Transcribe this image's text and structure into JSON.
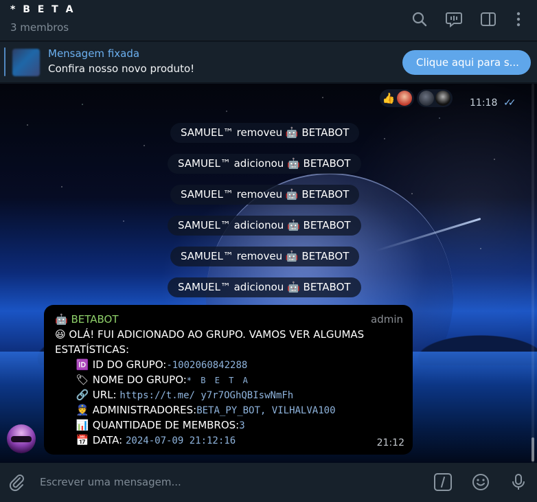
{
  "header": {
    "title": "* B E T A",
    "subtitle": "3 membros"
  },
  "pinned": {
    "title": "Mensagem fixada",
    "text": "Confira nosso novo produto!",
    "button_label": "Clique aqui para s..."
  },
  "top_message": {
    "time": "11:18",
    "ticks": "✓✓"
  },
  "service_messages": [
    {
      "actor": "SAMUEL™",
      "action": "removeu",
      "emoji": "🤖",
      "target": "BETABOT"
    },
    {
      "actor": "SAMUEL™",
      "action": "adicionou",
      "emoji": "🤖",
      "target": "BETABOT"
    },
    {
      "actor": "SAMUEL™",
      "action": "removeu",
      "emoji": "🤖",
      "target": "BETABOT"
    },
    {
      "actor": "SAMUEL™",
      "action": "adicionou",
      "emoji": "🤖",
      "target": "BETABOT"
    },
    {
      "actor": "SAMUEL™",
      "action": "removeu",
      "emoji": "🤖",
      "target": "BETABOT"
    },
    {
      "actor": "SAMUEL™",
      "action": "adicionou",
      "emoji": "🤖",
      "target": "BETABOT"
    }
  ],
  "bot_message": {
    "sender_emoji": "🤖",
    "sender": "BETABOT",
    "role": "admin",
    "greeting_emoji": "😃",
    "greeting_line1": "OLÁ! FUI ADICIONADO AO GRUPO. VAMOS VER ALGUMAS",
    "greeting_line2": "ESTATÍSTICAS:",
    "fields": [
      {
        "emoji": "🆔",
        "label": "ID DO GRUPO:",
        "value": "-1002060842288"
      },
      {
        "emoji": "🏷",
        "label": "NOME DO GRUPO:",
        "value": "* B E T A"
      },
      {
        "emoji": "🔗",
        "label": "URL:",
        "value": "https://t.me/ y7r7OGhQBIswNmFh"
      },
      {
        "emoji": "👮",
        "label": "ADMINISTRADORES:",
        "value": "BETA_PY_BOT, VILHALVA100"
      },
      {
        "emoji": "📊",
        "label": "QUANTIDADE DE MEMBROS:",
        "value": "3"
      },
      {
        "emoji": "📅",
        "label": "DATA:",
        "value": "2024-07-09 21:12:16"
      }
    ],
    "time": "21:12"
  },
  "composer": {
    "placeholder": "Escrever uma mensagem..."
  },
  "reactions": {
    "first_emoji": "👍"
  }
}
